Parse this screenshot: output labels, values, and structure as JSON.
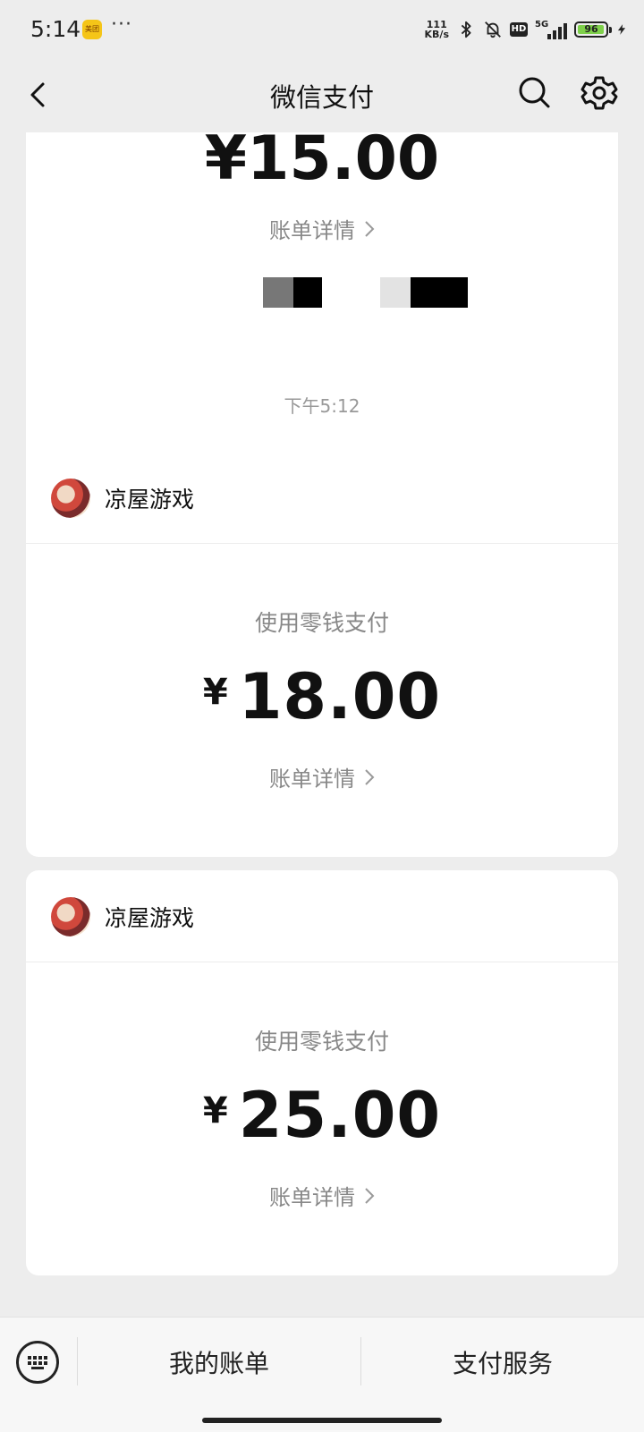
{
  "status_bar": {
    "time": "5:14",
    "app_icon_label": "美团",
    "more": "···",
    "net_speed_value": "111",
    "net_speed_unit": "KB/s",
    "hd": "HD",
    "network": "5G",
    "battery": "96",
    "battery_level": 0.96
  },
  "nav": {
    "title": "微信支付"
  },
  "previous_card": {
    "amount": "¥15.00",
    "detail_label": "账单详情"
  },
  "time_label": "下午5:12",
  "transactions": [
    {
      "merchant": "凉屋游戏",
      "method": "使用零钱支付",
      "currency": "¥",
      "amount": "18.00",
      "detail_label": "账单详情"
    },
    {
      "merchant": "凉屋游戏",
      "method": "使用零钱支付",
      "currency": "¥",
      "amount": "25.00",
      "detail_label": "账单详情"
    }
  ],
  "bottom_bar": {
    "my_bills": "我的账单",
    "pay_services": "支付服务"
  },
  "colors": {
    "background": "#ededed",
    "card": "#ffffff",
    "secondary_text": "#888888"
  }
}
